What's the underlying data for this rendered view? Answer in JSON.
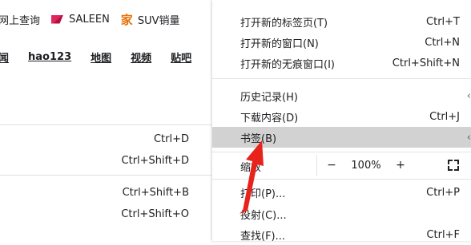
{
  "page": {
    "bookmarks_bar": [
      {
        "label": "网上查询"
      },
      {
        "label": "SALEEN"
      },
      {
        "label": "SUV销量"
      }
    ],
    "nav_links": [
      "闻",
      "hao123",
      "地图",
      "视频",
      "贴吧"
    ]
  },
  "bookmark_submenu": {
    "items": [
      {
        "shortcut": "Ctrl+D"
      },
      {
        "shortcut": "Ctrl+Shift+D"
      },
      {
        "shortcut": "Ctrl+Shift+B"
      },
      {
        "shortcut": "Ctrl+Shift+O"
      }
    ]
  },
  "menu": {
    "items": [
      {
        "label": "打开新的标签页(T)",
        "shortcut": "Ctrl+T"
      },
      {
        "label": "打开新的窗口(N)",
        "shortcut": "Ctrl+N"
      },
      {
        "label": "打开新的无痕窗口(I)",
        "shortcut": "Ctrl+Shift+N"
      },
      {
        "label": "历史记录(H)",
        "shortcut": ""
      },
      {
        "label": "下载内容(D)",
        "shortcut": "Ctrl+J"
      },
      {
        "label": "书签(B)",
        "shortcut": ""
      },
      {
        "label": "打印(P)...",
        "shortcut": "Ctrl+P"
      },
      {
        "label": "投射(C)...",
        "shortcut": ""
      },
      {
        "label": "查找(F)...",
        "shortcut": "Ctrl+F"
      }
    ],
    "zoom": {
      "label": "缩放",
      "minus": "−",
      "value": "100%",
      "plus": "+"
    }
  },
  "colors": {
    "highlight": "#d2d2d2",
    "annotation_arrow": "#e8231b",
    "saleen_logo": "#e0245e",
    "jia_logo": "#e8710a"
  },
  "icons": [
    "saleen-logo-icon",
    "jia-logo-icon",
    "fullscreen-icon",
    "submenu-arrow-icon",
    "annotation-arrow"
  ]
}
